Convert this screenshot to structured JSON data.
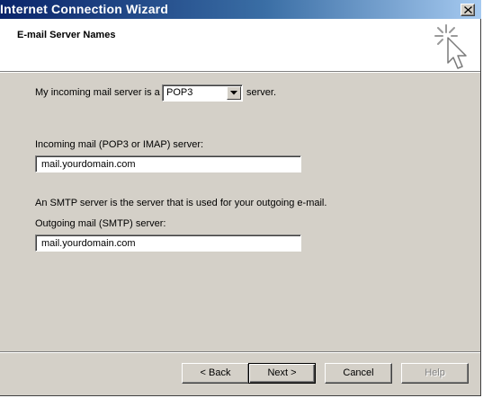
{
  "window": {
    "title": "Internet Connection Wizard"
  },
  "header": {
    "title": "E-mail Server Names",
    "icon": "wizard-cursor-icon"
  },
  "form": {
    "incoming_type_prefix": "My incoming mail server is a",
    "incoming_type_value": "POP3",
    "incoming_type_suffix": "server.",
    "incoming_server_label": "Incoming mail (POP3 or IMAP) server:",
    "incoming_server_value": "mail.yourdomain.com",
    "smtp_explanation": "An SMTP server is the server that is used for your outgoing e-mail.",
    "outgoing_server_label": "Outgoing mail (SMTP) server:",
    "outgoing_server_value": "mail.yourdomain.com"
  },
  "buttons": {
    "back": "< Back",
    "next": "Next >",
    "cancel": "Cancel",
    "help": "Help"
  }
}
